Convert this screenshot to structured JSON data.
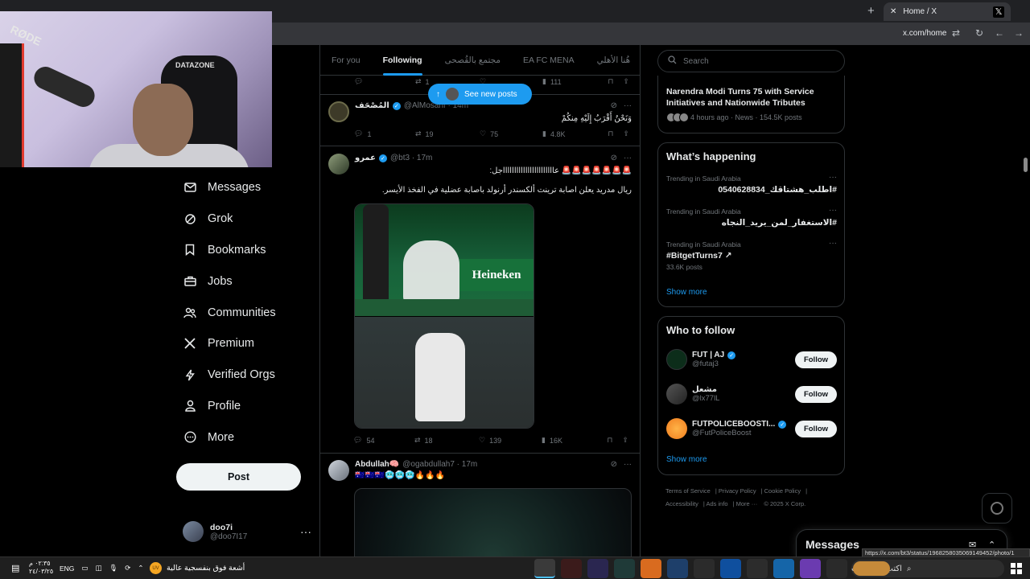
{
  "browser": {
    "tab_title": "Home / X",
    "url": "x.com/home"
  },
  "webcam": {
    "mic_brand": "RØDE",
    "chair_brand": "DATAZONE"
  },
  "nav": {
    "items": [
      {
        "label": "Messages",
        "icon": "envelope-icon"
      },
      {
        "label": "Grok",
        "icon": "grok-icon"
      },
      {
        "label": "Bookmarks",
        "icon": "bookmark-icon"
      },
      {
        "label": "Jobs",
        "icon": "briefcase-icon"
      },
      {
        "label": "Communities",
        "icon": "people-icon"
      },
      {
        "label": "Premium",
        "icon": "x-logo-icon"
      },
      {
        "label": "Verified Orgs",
        "icon": "lightning-icon"
      },
      {
        "label": "Profile",
        "icon": "person-icon"
      },
      {
        "label": "More",
        "icon": "more-circle-icon"
      }
    ],
    "post_label": "Post",
    "user": {
      "name": "doo7i",
      "handle": "@doo7I17"
    }
  },
  "feed": {
    "tabs": [
      "For you",
      "Following",
      "مجتمع بالقُصحى",
      "EA FC MENA",
      "هُنا الأهلي"
    ],
    "active_tab": "Following",
    "new_posts_label": "See new posts",
    "top_actions": {
      "replies": "",
      "reposts": "1",
      "likes": "",
      "views": "111"
    },
    "tweets": [
      {
        "name": "المُصْحَف",
        "handle": "@AlMosahf · 14m",
        "text": "وَنَحْنُ أَقْرَبُ إِلَيْهِ مِنكُمْ",
        "replies": "1",
        "reposts": "19",
        "likes": "75",
        "views": "4.8K"
      },
      {
        "name": "عمرو",
        "handle": "@bt3 · 17m",
        "text": "🚨🚨🚨🚨🚨🚨🚨 عاااااااااااااااااااااااجل:",
        "text2": "ريال مدريد يعلن اصابة ترينت ألكسندر أرنولد باصابة عضلية في الفخذ الأيسر.",
        "media_brand": "Heineken",
        "replies": "54",
        "reposts": "18",
        "likes": "139",
        "views": "16K"
      },
      {
        "name": "Abdullah🧠",
        "handle": "@ogabdullah7 · 17m",
        "text": "🇦🇺🇦🇺🇦🇺🥶🥶🥶🔥🔥🔥"
      }
    ]
  },
  "right": {
    "search_placeholder": "Search",
    "news": {
      "title": "Narendra Modi Turns 75 with Service Initiatives and Nationwide Tributes",
      "meta": "4 hours ago · News · 154.5K posts"
    },
    "happening_title": "What’s happening",
    "trends": [
      {
        "context": "Trending in Saudi Arabia",
        "tag": "#اطلب_هشتاقك_0540628834",
        "count": ""
      },
      {
        "context": "Trending in Saudi Arabia",
        "tag": "#الاستغفار_لمن_يريد_النجاه",
        "count": ""
      },
      {
        "context": "Trending in Saudi Arabia",
        "tag": "#BitgetTurns7 ↗",
        "count": "33.6K posts"
      }
    ],
    "show_more": "Show more",
    "who_to_follow_title": "Who to follow",
    "follow_suggestions": [
      {
        "name": "FUT | AJ",
        "handle": "@futaj3",
        "verified": true
      },
      {
        "name": "مشعل",
        "handle": "@lx77lL",
        "verified": false
      },
      {
        "name": "FUTPOLICEBOOSTI...",
        "handle": "@FutPoliceBoost",
        "verified": true
      }
    ],
    "follow_label": "Follow",
    "footer": [
      "Terms of Service",
      "Privacy Policy",
      "Cookie Policy",
      "Accessibility",
      "Ads info",
      "More ···",
      "© 2025 X Corp."
    ]
  },
  "messages_drawer": {
    "title": "Messages"
  },
  "status_url": "https://x.com/bt3/status/1968258035069149452/photo/1",
  "taskbar": {
    "time": "٠٢:٣٥ م",
    "date": "٢٤/٠٣/٢٥",
    "language": "ENG",
    "weather_text": "أشعة فوق بنفسجية عالية",
    "weather_badge": "UV",
    "search_placeholder": "اكتب هنا للبحث"
  },
  "colors": {
    "accent": "#1d9bf0",
    "background": "#000000",
    "border": "#2f3336"
  }
}
